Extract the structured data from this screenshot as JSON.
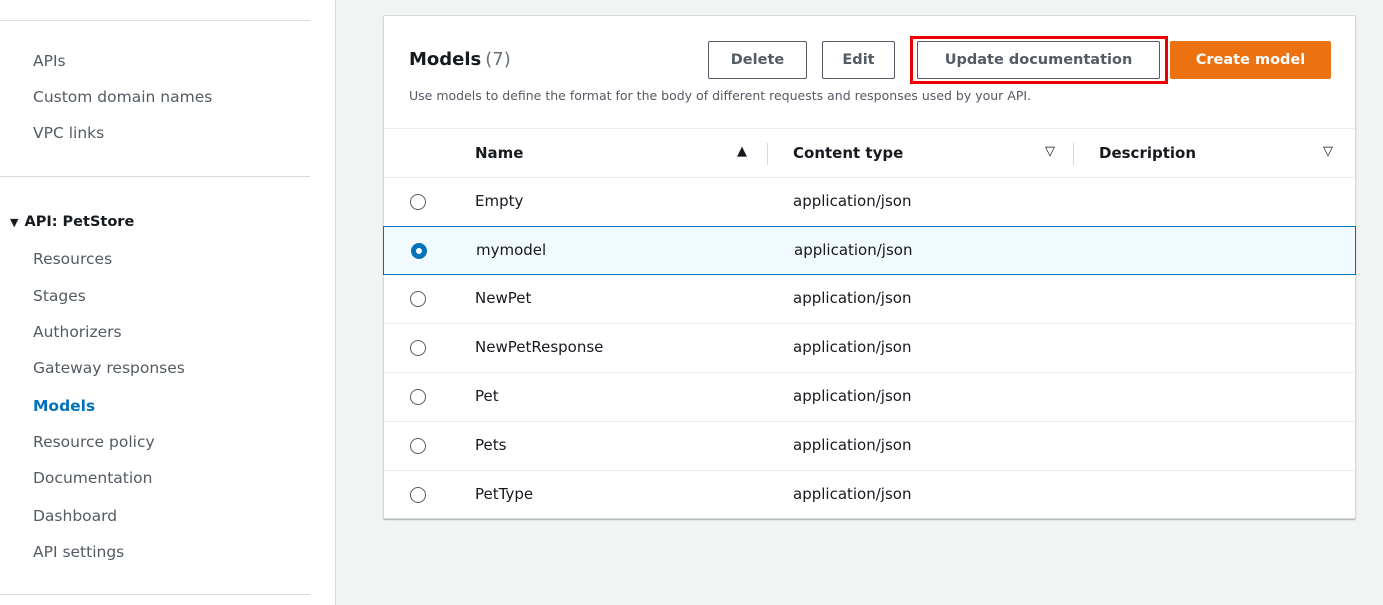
{
  "sidebar": {
    "top_items": [
      "APIs",
      "Custom domain names",
      "VPC links"
    ],
    "section_title": "API: PetStore",
    "section_items": [
      "Resources",
      "Stages",
      "Authorizers",
      "Gateway responses",
      "Models",
      "Resource policy",
      "Documentation",
      "Dashboard",
      "API settings"
    ],
    "active_item": "Models"
  },
  "panel": {
    "title": "Models",
    "count": "(7)",
    "description": "Use models to define the format for the body of different requests and responses used by your API.",
    "buttons": {
      "delete": "Delete",
      "edit": "Edit",
      "update_documentation": "Update documentation",
      "create_model": "Create model"
    }
  },
  "table": {
    "columns": [
      "Name",
      "Content type",
      "Description"
    ],
    "sort_icons": {
      "name": "▲",
      "content_type": "▽",
      "description": "▽"
    },
    "rows": [
      {
        "name": "Empty",
        "content_type": "application/json",
        "description": "",
        "selected": false
      },
      {
        "name": "mymodel",
        "content_type": "application/json",
        "description": "",
        "selected": true
      },
      {
        "name": "NewPet",
        "content_type": "application/json",
        "description": "",
        "selected": false
      },
      {
        "name": "NewPetResponse",
        "content_type": "application/json",
        "description": "",
        "selected": false
      },
      {
        "name": "Pet",
        "content_type": "application/json",
        "description": "",
        "selected": false
      },
      {
        "name": "Pets",
        "content_type": "application/json",
        "description": "",
        "selected": false
      },
      {
        "name": "PetType",
        "content_type": "application/json",
        "description": "",
        "selected": false
      }
    ]
  },
  "colors": {
    "accent": "#0073bb",
    "primary_button": "#ec7211",
    "highlight": "#ee0000"
  }
}
